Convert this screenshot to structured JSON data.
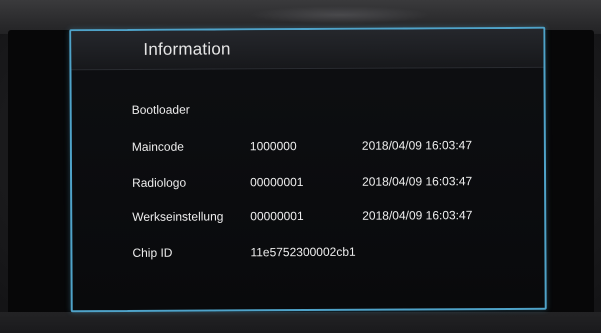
{
  "panel": {
    "title": "Information"
  },
  "rows": [
    {
      "label": "Bootloader",
      "value": "",
      "date": ""
    },
    {
      "label": "Maincode",
      "value": "1000000",
      "date": "2018/04/09 16:03:47"
    },
    {
      "label": "Radiologo",
      "value": "00000001",
      "date": "2018/04/09 16:03:47"
    },
    {
      "label": "Werkseinstellung",
      "value": "00000001",
      "date": "2018/04/09 16:03:47"
    },
    {
      "label": "Chip ID",
      "value": "11e5752300002cb1",
      "date": ""
    }
  ],
  "colors": {
    "frame": "#4fa3c9",
    "text": "#ededed",
    "background": "#090a0c"
  }
}
